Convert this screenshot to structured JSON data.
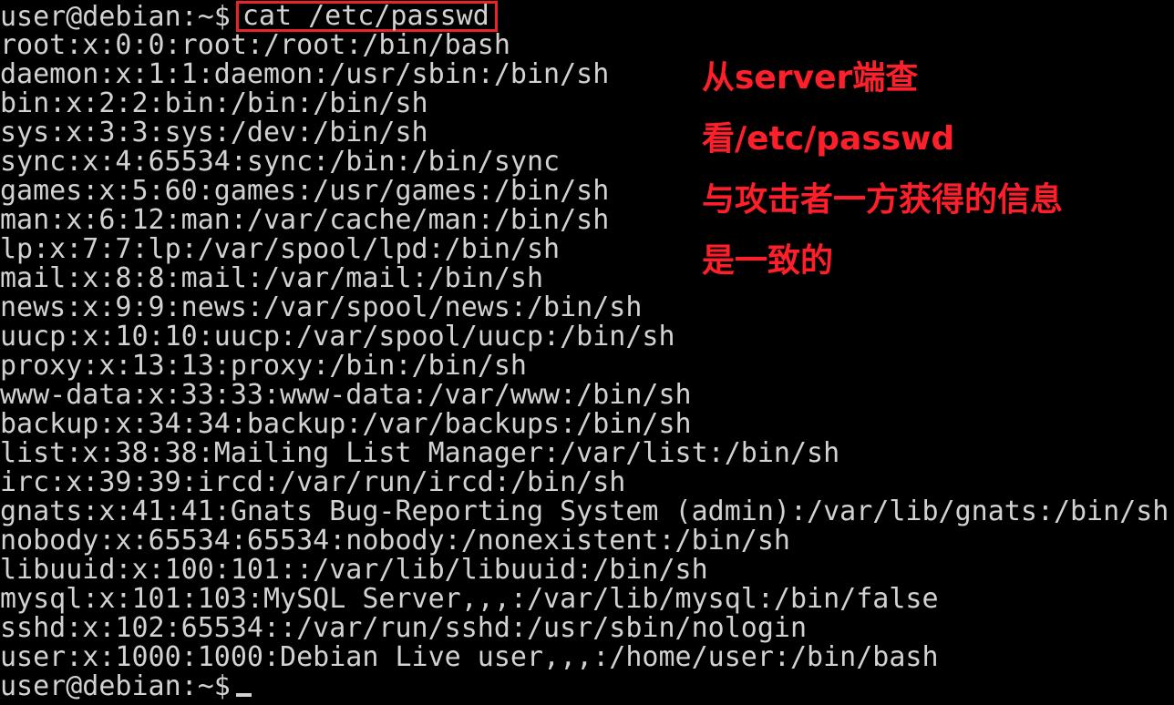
{
  "terminal": {
    "prompt": "user@debian:~$",
    "command": "cat /etc/passwd",
    "output": [
      "root:x:0:0:root:/root:/bin/bash",
      "daemon:x:1:1:daemon:/usr/sbin:/bin/sh",
      "bin:x:2:2:bin:/bin:/bin/sh",
      "sys:x:3:3:sys:/dev:/bin/sh",
      "sync:x:4:65534:sync:/bin:/bin/sync",
      "games:x:5:60:games:/usr/games:/bin/sh",
      "man:x:6:12:man:/var/cache/man:/bin/sh",
      "lp:x:7:7:lp:/var/spool/lpd:/bin/sh",
      "mail:x:8:8:mail:/var/mail:/bin/sh",
      "news:x:9:9:news:/var/spool/news:/bin/sh",
      "uucp:x:10:10:uucp:/var/spool/uucp:/bin/sh",
      "proxy:x:13:13:proxy:/bin:/bin/sh",
      "www-data:x:33:33:www-data:/var/www:/bin/sh",
      "backup:x:34:34:backup:/var/backups:/bin/sh",
      "list:x:38:38:Mailing List Manager:/var/list:/bin/sh",
      "irc:x:39:39:ircd:/var/run/ircd:/bin/sh",
      "gnats:x:41:41:Gnats Bug-Reporting System (admin):/var/lib/gnats:/bin/sh",
      "nobody:x:65534:65534:nobody:/nonexistent:/bin/sh",
      "libuuid:x:100:101::/var/lib/libuuid:/bin/sh",
      "mysql:x:101:103:MySQL Server,,,:/var/lib/mysql:/bin/false",
      "sshd:x:102:65534::/var/run/sshd:/usr/sbin/nologin",
      "user:x:1000:1000:Debian Live user,,,:/home/user:/bin/bash"
    ],
    "final_prompt": "user@debian:~$"
  },
  "annotation": {
    "lines": [
      "从server端查",
      "看/etc/passwd",
      "与攻击者一方获得的信息",
      "是一致的"
    ],
    "color": "#ff1f2b"
  },
  "colors": {
    "background": "#000000",
    "text": "#d2d2d2",
    "highlight_box": "#e8232a"
  }
}
